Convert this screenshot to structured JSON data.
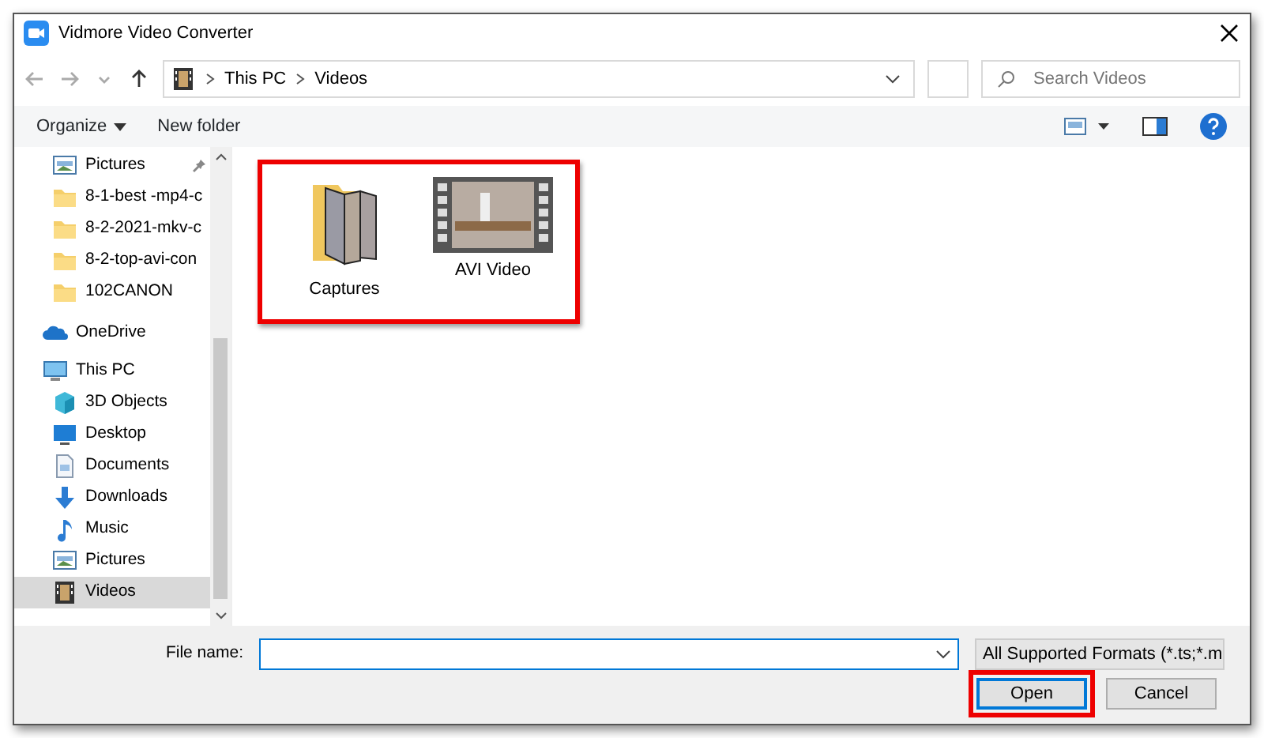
{
  "window": {
    "title": "Vidmore Video Converter"
  },
  "address": {
    "crumbs": [
      "This PC",
      "Videos"
    ]
  },
  "search": {
    "placeholder": "Search Videos"
  },
  "toolbar": {
    "organize": "Organize",
    "new_folder": "New folder"
  },
  "sidebar": {
    "quick_access_items": [
      {
        "label": "Pictures",
        "kind": "pictures",
        "pinned": true,
        "selected": false
      },
      {
        "label": "8-1-best -mp4-c",
        "kind": "folder",
        "pinned": false,
        "selected": false
      },
      {
        "label": "8-2-2021-mkv-c",
        "kind": "folder",
        "pinned": false,
        "selected": false
      },
      {
        "label": "8-2-top-avi-con",
        "kind": "folder",
        "pinned": false,
        "selected": false
      },
      {
        "label": "102CANON",
        "kind": "folder",
        "pinned": false,
        "selected": false
      }
    ],
    "tree": [
      {
        "label": "OneDrive",
        "kind": "cloud",
        "selected": false
      },
      {
        "label": "This PC",
        "kind": "pc",
        "selected": false,
        "children": [
          {
            "label": "3D Objects",
            "kind": "cube",
            "selected": false
          },
          {
            "label": "Desktop",
            "kind": "desktop",
            "selected": false
          },
          {
            "label": "Documents",
            "kind": "document",
            "selected": false
          },
          {
            "label": "Downloads",
            "kind": "download",
            "selected": false
          },
          {
            "label": "Music",
            "kind": "music",
            "selected": false
          },
          {
            "label": "Pictures",
            "kind": "pictures",
            "selected": false
          },
          {
            "label": "Videos",
            "kind": "videos",
            "selected": true
          }
        ]
      }
    ]
  },
  "files": {
    "highlighted": true,
    "items": [
      {
        "label": "Captures",
        "kind": "folder"
      },
      {
        "label": "AVI Video",
        "kind": "video"
      }
    ]
  },
  "footer": {
    "file_name_label": "File name:",
    "file_type": "All Supported Formats (*.ts;*.m",
    "buttons": [
      {
        "label": "Open",
        "highlighted": true
      },
      {
        "label": "Cancel",
        "highlighted": false
      }
    ]
  }
}
